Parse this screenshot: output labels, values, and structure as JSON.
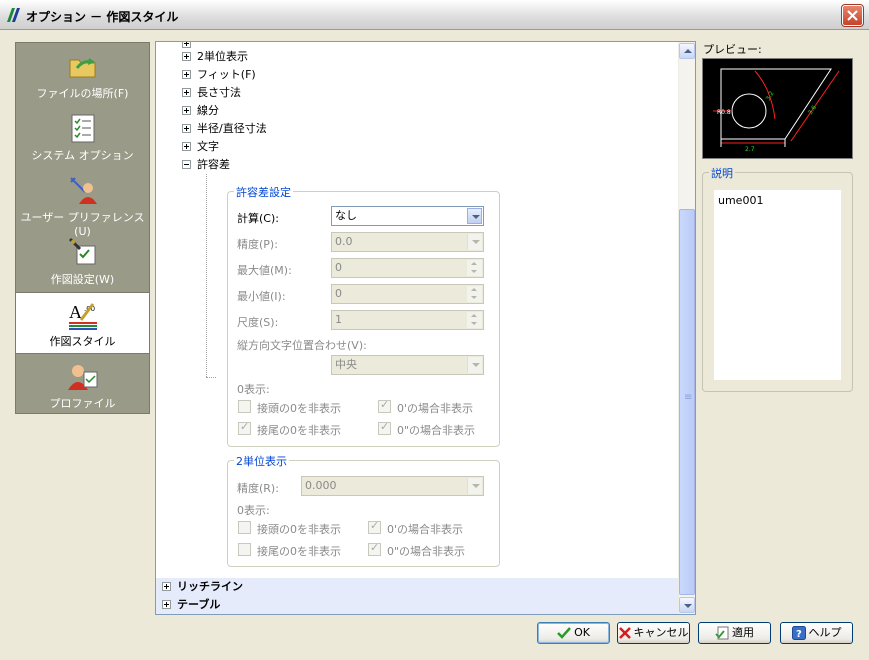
{
  "window": {
    "title": "オプション － 作図スタイル"
  },
  "sidebar": {
    "items": [
      {
        "label": "ファイルの場所(F)",
        "icon": "folder-arrow-icon"
      },
      {
        "label": "システム オプション",
        "icon": "checklist-icon"
      },
      {
        "label": "ユーザー プリファレンス(U)",
        "icon": "user-preferences-icon"
      },
      {
        "label": "作図設定(W)",
        "icon": "drawing-settings-icon"
      },
      {
        "label": "作図スタイル",
        "icon": "drawing-style-icon",
        "active": true
      },
      {
        "label": "プロファイル",
        "icon": "profile-icon"
      }
    ]
  },
  "tree": {
    "nodes": [
      {
        "label": "2単位表示",
        "expanded": false
      },
      {
        "label": "フィット(F)",
        "expanded": false
      },
      {
        "label": "長さ寸法",
        "expanded": false
      },
      {
        "label": "線分",
        "expanded": false
      },
      {
        "label": "半径/直径寸法",
        "expanded": false
      },
      {
        "label": "文字",
        "expanded": false
      },
      {
        "label": "許容差",
        "expanded": true
      }
    ],
    "bottom_nodes": [
      {
        "label": "リッチライン"
      },
      {
        "label": "テーブル"
      }
    ]
  },
  "tolerance": {
    "legend": "許容差設定",
    "calc_label": "計算(C):",
    "calc_value": "なし",
    "precision_label": "精度(P):",
    "precision_value": "0.0",
    "max_label": "最大値(M):",
    "max_value": "0",
    "min_label": "最小値(I):",
    "min_value": "0",
    "scale_label": "尺度(S):",
    "scale_value": "1",
    "valign_label": "縦方向文字位置合わせ(V):",
    "valign_value": "中央",
    "zero_label": "0表示:",
    "checks": [
      {
        "label": "接頭の0を非表示",
        "checked": false
      },
      {
        "label": "0'の場合非表示",
        "checked": true
      },
      {
        "label": "接尾の0を非表示",
        "checked": true
      },
      {
        "label": "0\"の場合非表示",
        "checked": true
      }
    ]
  },
  "alt_units": {
    "legend": "2単位表示",
    "precision_label": "精度(R):",
    "precision_value": "0.000",
    "zero_label": "0表示:",
    "checks": [
      {
        "label": "接頭の0を非表示",
        "checked": false
      },
      {
        "label": "0'の場合非表示",
        "checked": true
      },
      {
        "label": "接尾の0を非表示",
        "checked": false
      },
      {
        "label": "0\"の場合非表示",
        "checked": true
      }
    ]
  },
  "right": {
    "preview_label": "プレビュー:",
    "preview_texts": [
      "R0.8",
      "3.2",
      "2.7",
      "3.6"
    ],
    "desc_legend": "説明",
    "desc_text": "ume001"
  },
  "buttons": {
    "ok": "OK",
    "cancel": "キャンセル",
    "apply": "適用",
    "help": "ヘルプ"
  },
  "colors": {
    "accent": "#0046d5",
    "sidebar_bg": "#9a9a88",
    "preview_bg": "#000000"
  }
}
